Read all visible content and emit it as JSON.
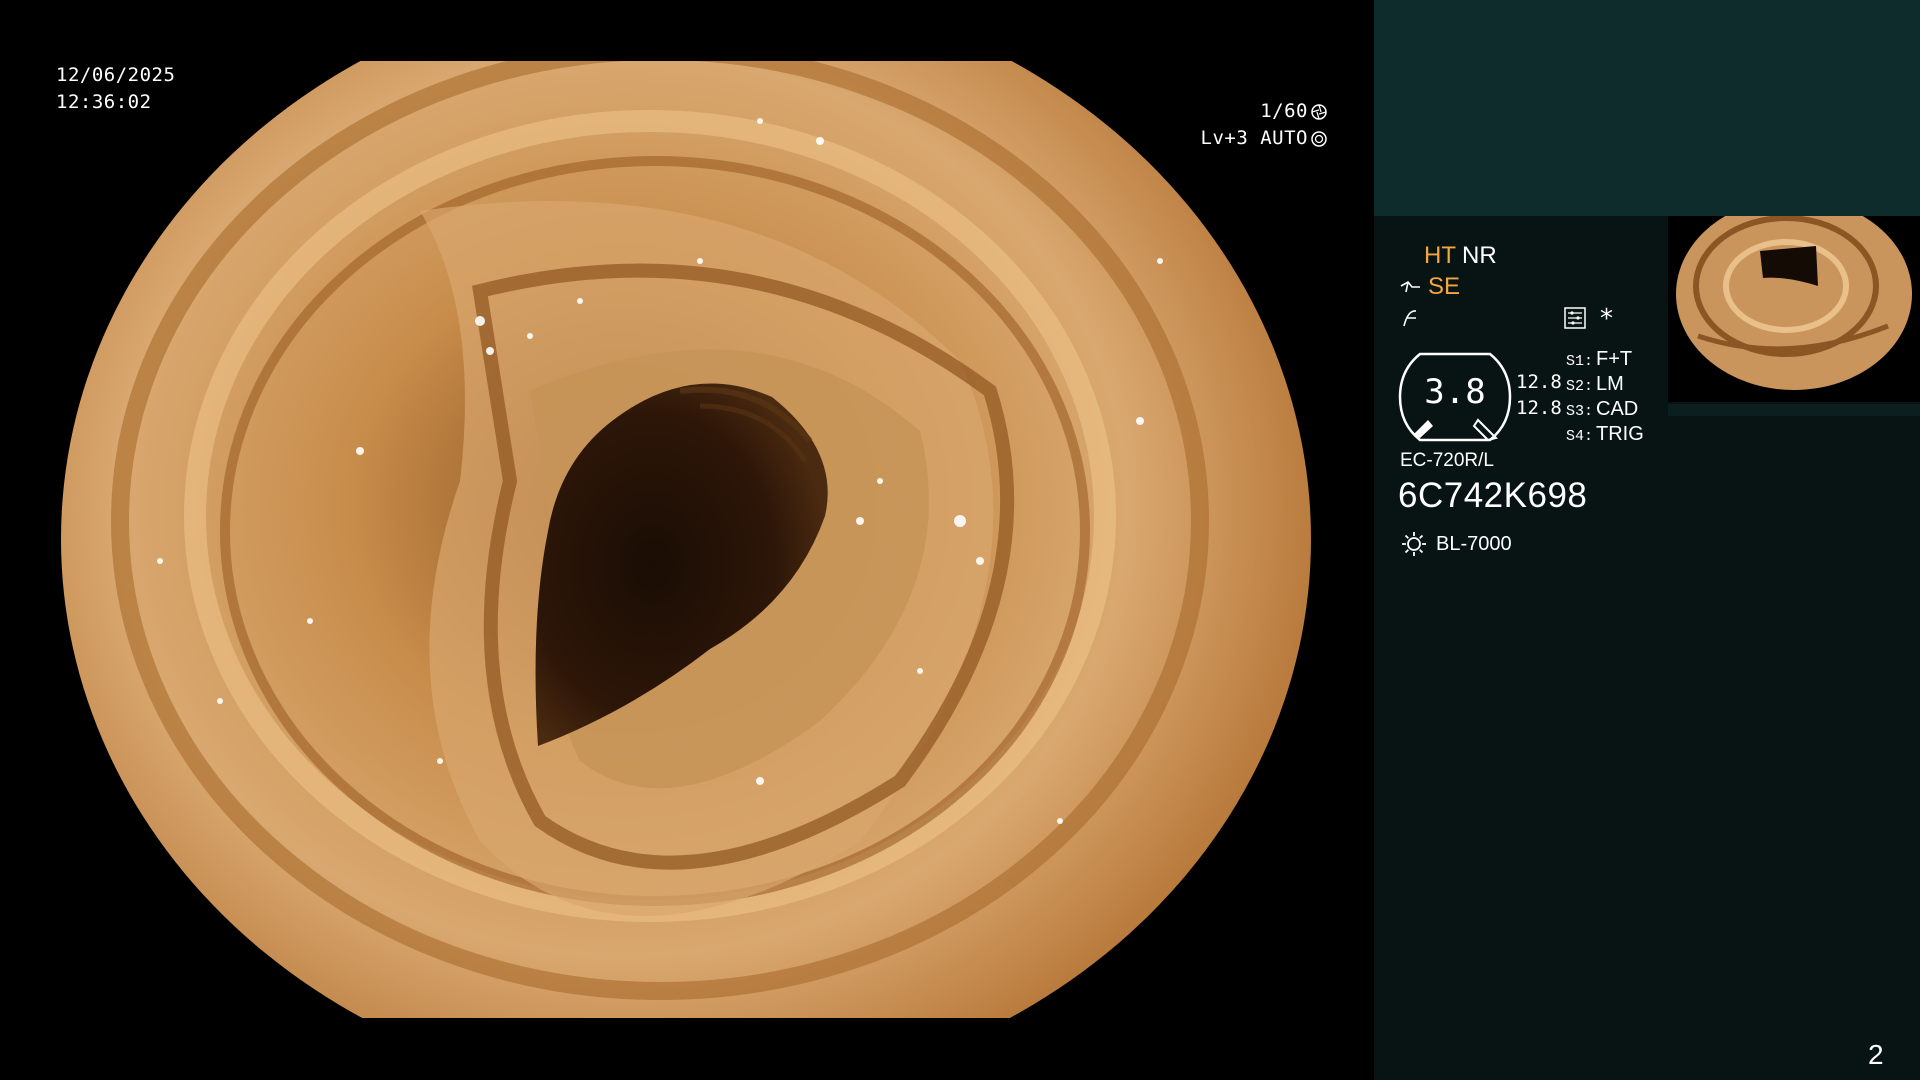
{
  "view": {
    "date": "12/06/2025",
    "time": "12:36:02",
    "shutter": "1/60",
    "iris_mode": "Lv+3 AUTO"
  },
  "panel": {
    "modes": {
      "ht": "HT",
      "nr": "NR",
      "se": "SE"
    },
    "zoom": "3.8",
    "zoom_side_1": "12.8",
    "zoom_side_2": "12.8",
    "switches": [
      {
        "key": "S1:",
        "value": "F+T"
      },
      {
        "key": "S2:",
        "value": "LM"
      },
      {
        "key": "S3:",
        "value": "CAD"
      },
      {
        "key": "S4:",
        "value": "TRIG"
      }
    ],
    "scope_model": "EC-720R/L",
    "scope_serial": "6C742K698",
    "light_source": "BL-7000",
    "page_number": "2"
  },
  "colors": {
    "accent": "#f4a640",
    "panel_dark": "#081413",
    "panel_top": "#0f2c2c"
  },
  "icons": [
    "shutter-icon",
    "iris-icon",
    "scope-cable-icon",
    "freeze-icon",
    "settings-icon",
    "light-source-icon"
  ]
}
